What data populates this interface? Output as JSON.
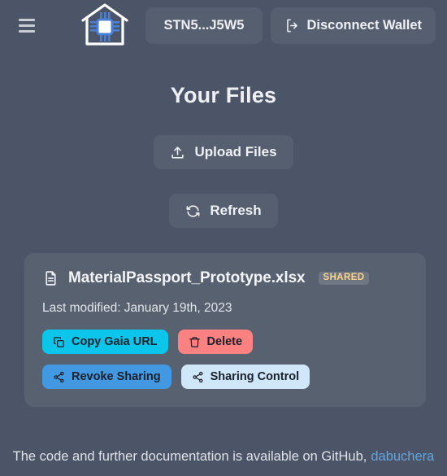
{
  "header": {
    "menu_icon": "hamburger-menu-icon",
    "logo_icon": "smart-house-chip-logo",
    "wallet_address": "STN5...J5W5",
    "disconnect_label": "Disconnect Wallet",
    "disconnect_icon": "logout-icon"
  },
  "main": {
    "title": "Your Files",
    "upload_label": "Upload Files",
    "upload_icon": "upload-icon",
    "refresh_label": "Refresh",
    "refresh_icon": "refresh-icon"
  },
  "file_card": {
    "file_icon": "document-icon",
    "file_name": "MaterialPassport_Prototype.xlsx",
    "badge": "SHARED",
    "last_modified": "Last modified: January 19th, 2023",
    "actions": [
      {
        "label": "Copy Gaia URL",
        "icon": "copy-icon",
        "color": "#0bc5ea"
      },
      {
        "label": "Delete",
        "icon": "trash-icon",
        "color": "#fc8181"
      },
      {
        "label": "Revoke Sharing",
        "icon": "share-icon",
        "color": "#4299e1"
      },
      {
        "label": "Sharing Control",
        "icon": "share-icon",
        "color": "#cfe7f8"
      }
    ]
  },
  "footer": {
    "text": "The code and further documentation is available on GitHub,",
    "link": "dabuchera"
  },
  "colors": {
    "page_background": "#4c5568",
    "card_background": "#58616f",
    "button_background": "#565f6f",
    "badge_text": "#fbd38d",
    "link": "#63a4dd",
    "logo_accent": "#4a7fd4"
  }
}
